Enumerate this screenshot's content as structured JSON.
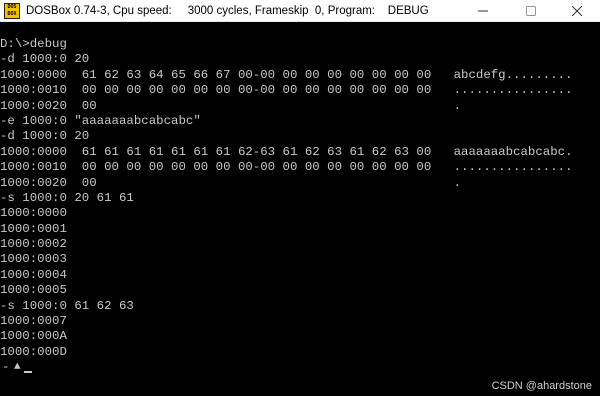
{
  "window": {
    "title": "DOSBox 0.74-3, Cpu speed:     3000 cycles, Frameskip  0, Program:    DEBUG",
    "icon_text": "DOS\nBOX"
  },
  "terminal": {
    "lines": [
      "D:\\>debug",
      "-d 1000:0 20",
      "1000:0000  61 62 63 64 65 66 67 00-00 00 00 00 00 00 00 00   abcdefg.........",
      "1000:0010  00 00 00 00 00 00 00 00-00 00 00 00 00 00 00 00   ................",
      "1000:0020  00                                                .",
      "-e 1000:0 \"aaaaaaabcabcabc\"",
      "-d 1000:0 20",
      "1000:0000  61 61 61 61 61 61 61 62-63 61 62 63 61 62 63 00   aaaaaaabcabcabc.",
      "1000:0010  00 00 00 00 00 00 00 00-00 00 00 00 00 00 00 00   ................",
      "1000:0020  00                                                .",
      "-s 1000:0 20 61 61",
      "1000:0000",
      "1000:0001",
      "1000:0002",
      "1000:0003",
      "1000:0004",
      "1000:0005",
      "-s 1000:0 61 62 63",
      "1000:0007",
      "1000:000A",
      "1000:000D"
    ],
    "prompt": "-",
    "prompt_caret": "▲"
  },
  "watermark": "CSDN @ahardstone",
  "colors": {
    "terminal_bg": "#000000",
    "terminal_fg": "#c8c8c8",
    "titlebar_bg": "#ffffff"
  }
}
